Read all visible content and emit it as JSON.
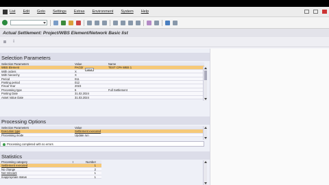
{
  "menu": {
    "items": [
      "List",
      "Edit",
      "Goto",
      "Settings",
      "Extras",
      "Environment",
      "System",
      "Help"
    ]
  },
  "title": "Actual Settlement: Project/WBS Element/Network Basic list",
  "selection": {
    "heading": "Selection Parameters",
    "columns": [
      "Selection Parameters",
      "Value",
      "Name"
    ],
    "rows": [
      {
        "param": "WBS Element",
        "value": "PA/23/",
        "name": "TEST CPA WBS 1"
      },
      {
        "param": "With orders",
        "value": "X",
        "name": ""
      },
      {
        "param": "With hierarchy",
        "value": "X",
        "name": ""
      },
      {
        "param": "Period",
        "value": "011",
        "name": ""
      },
      {
        "param": "Posting period",
        "value": "012",
        "name": ""
      },
      {
        "param": "Fiscal Year",
        "value": "2023",
        "name": ""
      },
      {
        "param": "Processing type",
        "value": "6",
        "name": "Full Settlement"
      },
      {
        "param": "Posting Date",
        "value": "31.02.2024",
        "name": ""
      },
      {
        "param": "Asset Value Date",
        "value": "31.03.2024",
        "name": ""
      }
    ],
    "tooltip": "Value"
  },
  "processing": {
    "heading": "Processing Options",
    "columns": [
      "Selection Parameters",
      "Value"
    ],
    "rows": [
      {
        "param": "Execution type",
        "value": "Settlement executed"
      },
      {
        "param": "Processing mode",
        "value": "Update run"
      }
    ]
  },
  "message": "Processing completed with no errors",
  "statistics": {
    "heading": "Statistics",
    "columns": [
      "Processing category",
      "I",
      "Number"
    ],
    "rows": [
      {
        "cat": "Settlement executed",
        "i": "",
        "num": "1"
      },
      {
        "cat": "No change",
        "i": "",
        "num": "2"
      },
      {
        "cat": "Not relevant",
        "i": "",
        "num": "1"
      },
      {
        "cat": "Inappropriate status",
        "i": "",
        "num": "1"
      }
    ]
  }
}
